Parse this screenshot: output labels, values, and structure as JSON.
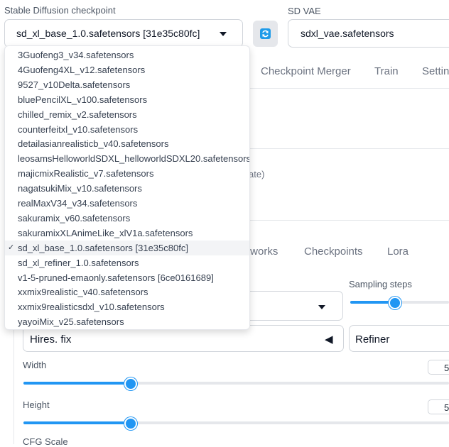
{
  "checkpoint": {
    "label": "Stable Diffusion checkpoint",
    "value": "sd_xl_base_1.0.safetensors [31e35c80fc]",
    "options": [
      "3Guofeng3_v34.safetensors",
      "4Guofeng4XL_v12.safetensors",
      "9527_v10Delta.safetensors",
      "bluePencilXL_v100.safetensors",
      "chilled_remix_v2.safetensors",
      "counterfeitxl_v10.safetensors",
      "detailasianrealisticb_v40.safetensors",
      "leosamsHelloworldSDXL_helloworldSDXL20.safetensors",
      "majicmixRealistic_v7.safetensors",
      "nagatsukiMix_v10.safetensors",
      "realMaxV34_v34.safetensors",
      "sakuramix_v60.safetensors",
      "sakuramixXLAnimeLike_xlV1a.safetensors",
      "sd_xl_base_1.0.safetensors [31e35c80fc]",
      "sd_xl_refiner_1.0.safetensors",
      "v1-5-pruned-emaonly.safetensors [6ce0161689]",
      "xxmix9realistic_v40.safetensors",
      "xxmix9realisticsdxl_v10.safetensors",
      "yayoiMix_v25.safetensors"
    ],
    "selected_index": 13,
    "check_glyph": "✓"
  },
  "vae": {
    "label": "SD VAE",
    "value": "sdxl_vae.safetensors"
  },
  "top_tabs": [
    "Checkpoint Merger",
    "Train",
    "Settin"
  ],
  "partial_text": "ate)",
  "sub_tabs": [
    "tworks",
    "Checkpoints",
    "Lora"
  ],
  "sampling_steps": {
    "label": "Sampling steps",
    "value_fraction": 0.35
  },
  "hires": {
    "label": "Hires. fix",
    "arrow": "◀"
  },
  "refiner": {
    "label": "Refiner"
  },
  "width": {
    "label": "Width",
    "value": "5",
    "value_fraction": 0.25
  },
  "height": {
    "label": "Height",
    "value": "5",
    "value_fraction": 0.25
  },
  "cfg": {
    "label": "CFG Scale"
  },
  "icons": {
    "refresh": "refresh-icon",
    "chevron": "chevron-down-icon"
  },
  "colors": {
    "accent": "#2196f3",
    "refresh_bg": "#e5e7eb"
  }
}
